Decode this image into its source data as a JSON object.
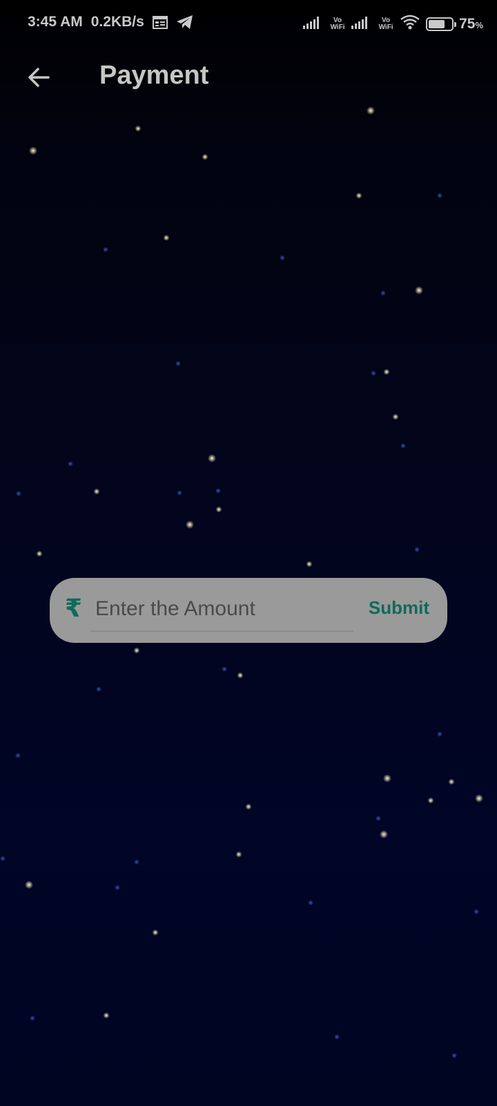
{
  "status_bar": {
    "time": "3:45 AM",
    "network_speed": "0.2KB/s",
    "left_icons": [
      "calendar-icon",
      "telegram-icon"
    ],
    "sim1_label_top": "Vo",
    "sim1_label_bottom": "WiFi",
    "sim2_label_top": "Vo",
    "sim2_label_bottom": "WiFi",
    "battery_percent": "75",
    "battery_percent_sign": "%",
    "battery_level": 0.75
  },
  "app_bar": {
    "back_icon": "arrow-left-icon",
    "title": "Payment"
  },
  "payment_form": {
    "currency_symbol": "₹",
    "amount_placeholder": "Enter the Amount",
    "amount_value": "",
    "submit_label": "Submit"
  },
  "colors": {
    "accent": "#0f6a5a",
    "form_background": "#9a9a9a",
    "background_dark": "#02051c"
  }
}
